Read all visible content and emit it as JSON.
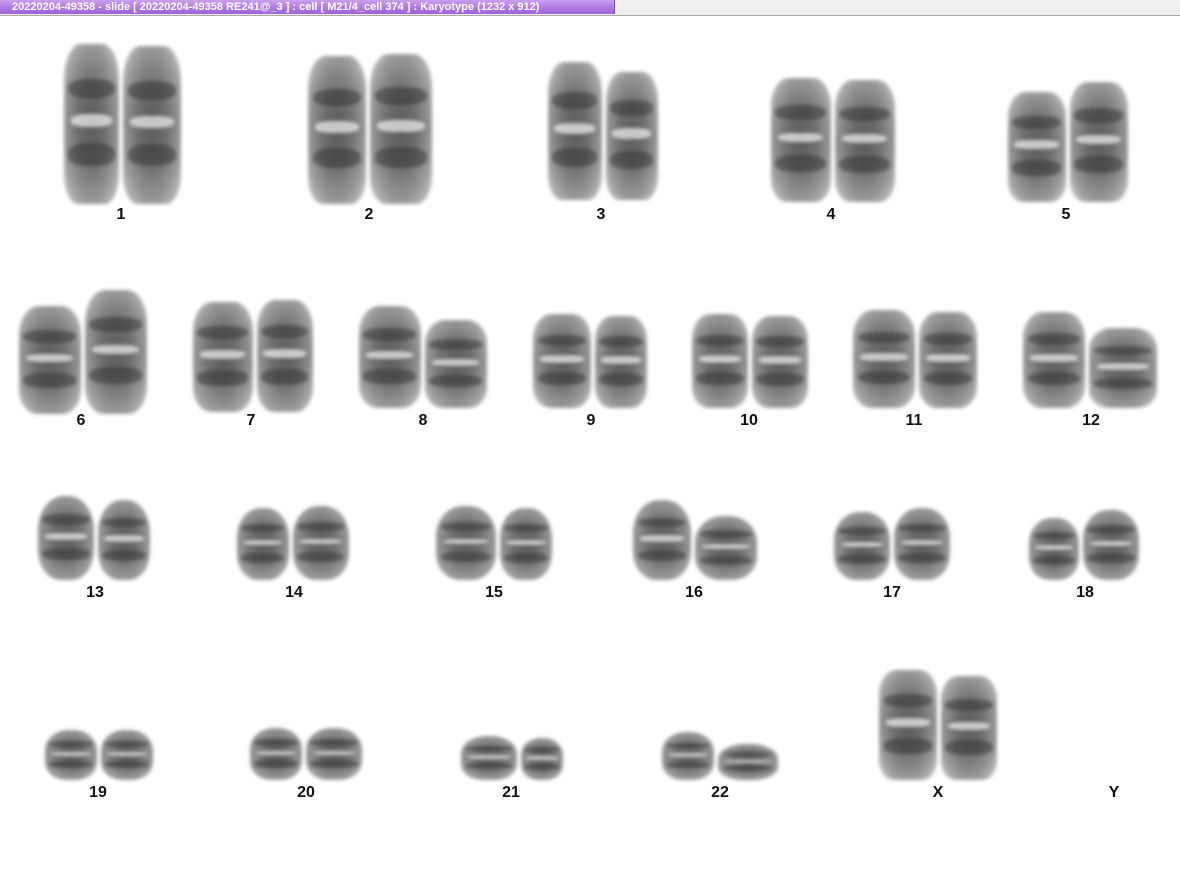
{
  "window": {
    "title": "20220204-49358 - slide [ 20220204-49358 RE241@_3 ] : cell [ M21/4_cell 374 ] : Karyotype  (1232 x 912)"
  },
  "karyotype": {
    "labels": {
      "c1": "1",
      "c2": "2",
      "c3": "3",
      "c4": "4",
      "c5": "5",
      "c6": "6",
      "c7": "7",
      "c8": "8",
      "c9": "9",
      "c10": "10",
      "c11": "11",
      "c12": "12",
      "c13": "13",
      "c14": "14",
      "c15": "15",
      "c16": "16",
      "c17": "17",
      "c18": "18",
      "c19": "19",
      "c20": "20",
      "c21": "21",
      "c22": "22",
      "cX": "X",
      "cY": "Y"
    }
  }
}
